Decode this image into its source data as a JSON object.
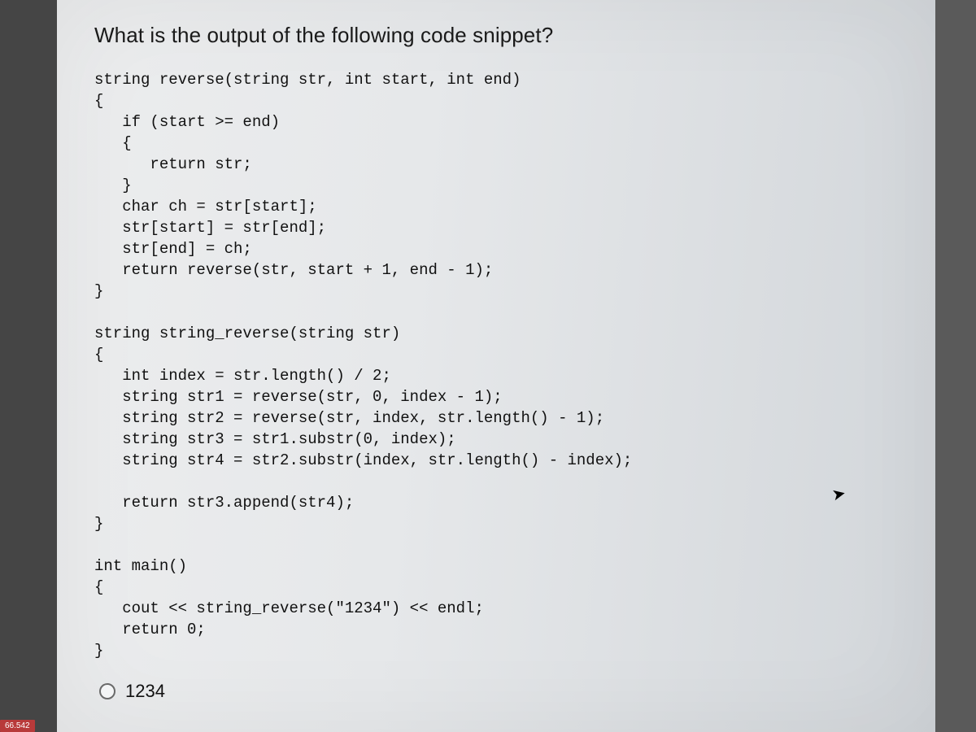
{
  "question": {
    "title": "What is the output of the following code snippet?"
  },
  "code": {
    "l01": "string reverse(string str, int start, int end)",
    "l02": "{",
    "l03": "   if (start >= end)",
    "l04": "   {",
    "l05": "      return str;",
    "l06": "   }",
    "l07": "   char ch = str[start];",
    "l08": "   str[start] = str[end];",
    "l09": "   str[end] = ch;",
    "l10": "   return reverse(str, start + 1, end - 1);",
    "l11": "}",
    "l12": "",
    "l13": "string string_reverse(string str)",
    "l14": "{",
    "l15": "   int index = str.length() / 2;",
    "l16": "   string str1 = reverse(str, 0, index - 1);",
    "l17": "   string str2 = reverse(str, index, str.length() - 1);",
    "l18": "   string str3 = str1.substr(0, index);",
    "l19": "   string str4 = str2.substr(index, str.length() - index);",
    "l20": "",
    "l21": "   return str3.append(str4);",
    "l22": "}",
    "l23": "",
    "l24": "int main()",
    "l25": "{",
    "l26": "   cout << string_reverse(\"1234\") << endl;",
    "l27": "   return 0;",
    "l28": "}"
  },
  "answers": {
    "option1": "1234"
  },
  "bottom_tag": "66.542"
}
